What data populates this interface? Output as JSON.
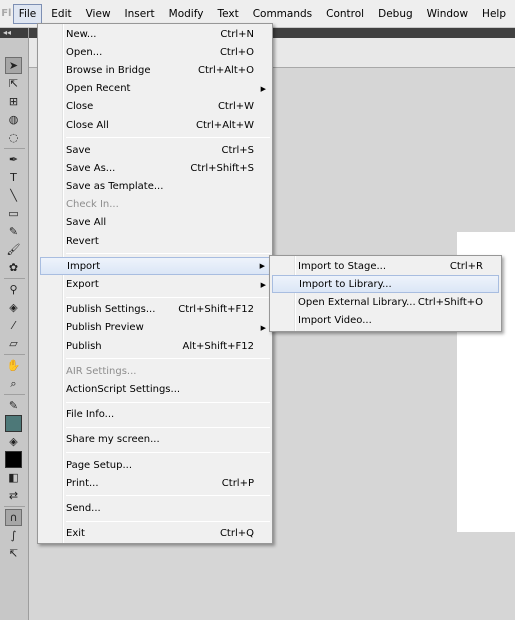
{
  "app": {
    "logo": "Fl"
  },
  "menubar": {
    "items": [
      "File",
      "Edit",
      "View",
      "Insert",
      "Modify",
      "Text",
      "Commands",
      "Control",
      "Debug",
      "Window",
      "Help"
    ]
  },
  "toolbar": {
    "collapse": "◂◂"
  },
  "file_menu": [
    {
      "label": "New...",
      "shortcut": "Ctrl+N"
    },
    {
      "label": "Open...",
      "shortcut": "Ctrl+O"
    },
    {
      "label": "Browse in Bridge",
      "shortcut": "Ctrl+Alt+O"
    },
    {
      "label": "Open Recent",
      "shortcut": "",
      "submenu": true
    },
    {
      "label": "Close",
      "shortcut": "Ctrl+W"
    },
    {
      "label": "Close All",
      "shortcut": "Ctrl+Alt+W"
    },
    {
      "label": "Save",
      "shortcut": "Ctrl+S"
    },
    {
      "label": "Save As...",
      "shortcut": "Ctrl+Shift+S"
    },
    {
      "label": "Save as Template...",
      "shortcut": ""
    },
    {
      "label": "Check In...",
      "shortcut": "",
      "disabled": true
    },
    {
      "label": "Save All",
      "shortcut": ""
    },
    {
      "label": "Revert",
      "shortcut": ""
    },
    {
      "label": "Import",
      "shortcut": "",
      "submenu": true,
      "highlighted": true
    },
    {
      "label": "Export",
      "shortcut": "",
      "submenu": true
    },
    {
      "label": "Publish Settings...",
      "shortcut": "Ctrl+Shift+F12"
    },
    {
      "label": "Publish Preview",
      "shortcut": "",
      "submenu": true
    },
    {
      "label": "Publish",
      "shortcut": "Alt+Shift+F12"
    },
    {
      "label": "AIR Settings...",
      "shortcut": "",
      "disabled": true
    },
    {
      "label": "ActionScript Settings...",
      "shortcut": ""
    },
    {
      "label": "File Info...",
      "shortcut": ""
    },
    {
      "label": "Share my screen...",
      "shortcut": ""
    },
    {
      "label": "Page Setup...",
      "shortcut": ""
    },
    {
      "label": "Print...",
      "shortcut": "Ctrl+P"
    },
    {
      "label": "Send...",
      "shortcut": ""
    },
    {
      "label": "Exit",
      "shortcut": "Ctrl+Q"
    }
  ],
  "import_submenu": [
    {
      "label": "Import to Stage...",
      "shortcut": "Ctrl+R"
    },
    {
      "label": "Import to Library...",
      "shortcut": "",
      "highlighted": true
    },
    {
      "label": "Open External Library...",
      "shortcut": "Ctrl+Shift+O"
    },
    {
      "label": "Import Video...",
      "shortcut": ""
    }
  ],
  "colors": {
    "highlight": "#dbe6f6",
    "stroke_swatch": "#4d7878",
    "fill_swatch": "#000000"
  }
}
